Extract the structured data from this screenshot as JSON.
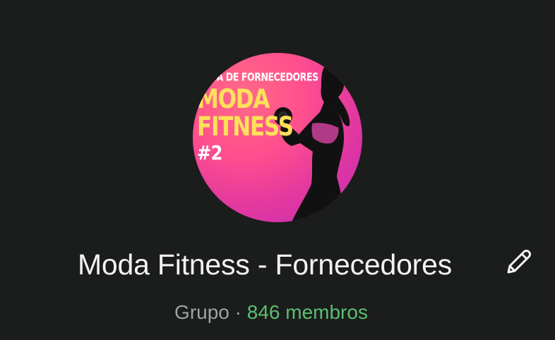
{
  "avatar": {
    "subtitle": "LISTA DE FORNECEDORES",
    "title_line1": "MODA",
    "title_line2": "FITNESS",
    "number": "#2"
  },
  "group": {
    "name": "Moda Fitness - Fornecedores",
    "type": "Grupo",
    "separator": "·",
    "members": "846 membros"
  },
  "colors": {
    "background": "#1b1c1c",
    "members_accent": "#5bbf72",
    "muted_text": "#9fa3a5"
  },
  "icons": {
    "edit": "pencil-icon"
  }
}
